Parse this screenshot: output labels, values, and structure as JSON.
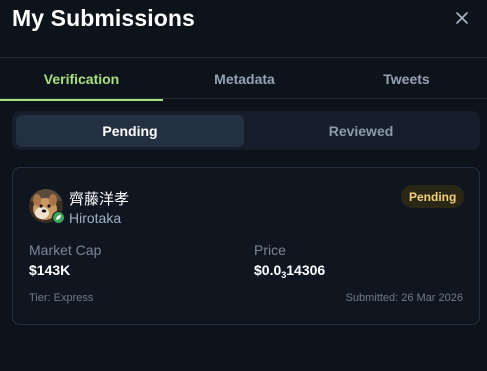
{
  "header": {
    "title": "My Submissions"
  },
  "tabs": [
    {
      "label": "Verification",
      "active": true
    },
    {
      "label": "Metadata",
      "active": false
    },
    {
      "label": "Tweets",
      "active": false
    }
  ],
  "filter": [
    {
      "label": "Pending",
      "active": true
    },
    {
      "label": "Reviewed",
      "active": false
    }
  ],
  "submission": {
    "name": "齊藤洋孝",
    "handle": "Hirotaka",
    "status": "Pending",
    "market_cap_label": "Market Cap",
    "market_cap_value": "$143K",
    "price_label": "Price",
    "price_prefix": "$0.0",
    "price_zero_count": "3",
    "price_digits": "14306",
    "tier": "Tier: Express",
    "submitted": "Submitted: 26 Mar 2026"
  },
  "colors": {
    "accent": "#a8e07f",
    "pending": "#f2d27a",
    "background": "#0d131b"
  }
}
